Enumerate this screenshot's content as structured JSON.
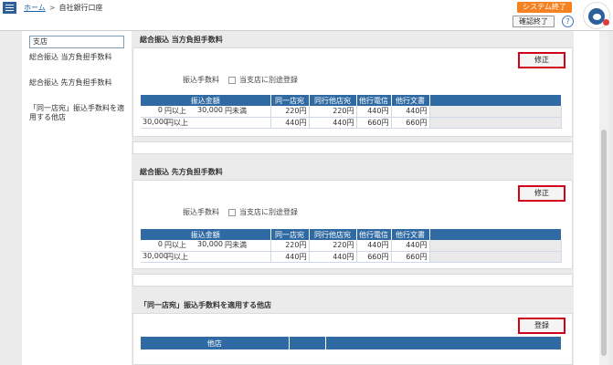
{
  "header": {
    "breadcrumb_home": "ホーム",
    "breadcrumb_sep": ">",
    "breadcrumb_current": "自社銀行口座",
    "system_exit_label": "システム終了",
    "confirm_exit_label": "確認終了",
    "help_label": "?"
  },
  "sidebar": {
    "items": [
      {
        "label": "支店"
      },
      {
        "label": "総合振込 当方負担手数料"
      },
      {
        "label": "総合振込 先方負担手数料"
      },
      {
        "label": "「同一店宛」振込手数料を適用する他店"
      }
    ]
  },
  "sections": [
    {
      "title": "総合振込 当方負担手数料",
      "edit_label": "修正",
      "fee_label": "振込手数料",
      "checkbox_label": "当支店に別途登録",
      "headers": [
        "振込金額",
        "同一店宛",
        "同行他店宛",
        "他行電信",
        "他行文書"
      ],
      "rows": [
        {
          "from": "0",
          "from_unit": "円以上",
          "to": "30,000",
          "to_unit": "円未満",
          "same_branch": "220円",
          "same_bank_other": "220円",
          "other_wire": "440円",
          "other_doc": "440円"
        },
        {
          "from": "30,000",
          "from_unit": "円以上",
          "to": "",
          "to_unit": "",
          "same_branch": "440円",
          "same_bank_other": "440円",
          "other_wire": "660円",
          "other_doc": "660円"
        }
      ]
    },
    {
      "title": "総合振込 先方負担手数料",
      "edit_label": "修正",
      "fee_label": "振込手数料",
      "checkbox_label": "当支店に別途登録",
      "headers": [
        "振込金額",
        "同一店宛",
        "同行他店宛",
        "他行電信",
        "他行文書"
      ],
      "rows": [
        {
          "from": "0",
          "from_unit": "円以上",
          "to": "30,000",
          "to_unit": "円未満",
          "same_branch": "220円",
          "same_bank_other": "220円",
          "other_wire": "440円",
          "other_doc": "440円"
        },
        {
          "from": "30,000",
          "from_unit": "円以上",
          "to": "",
          "to_unit": "",
          "same_branch": "440円",
          "same_bank_other": "440円",
          "other_wire": "660円",
          "other_doc": "660円"
        }
      ]
    }
  ],
  "other_store": {
    "title": "「同一店宛」振込手数料を適用する他店",
    "register_label": "登録",
    "header": "他店"
  }
}
